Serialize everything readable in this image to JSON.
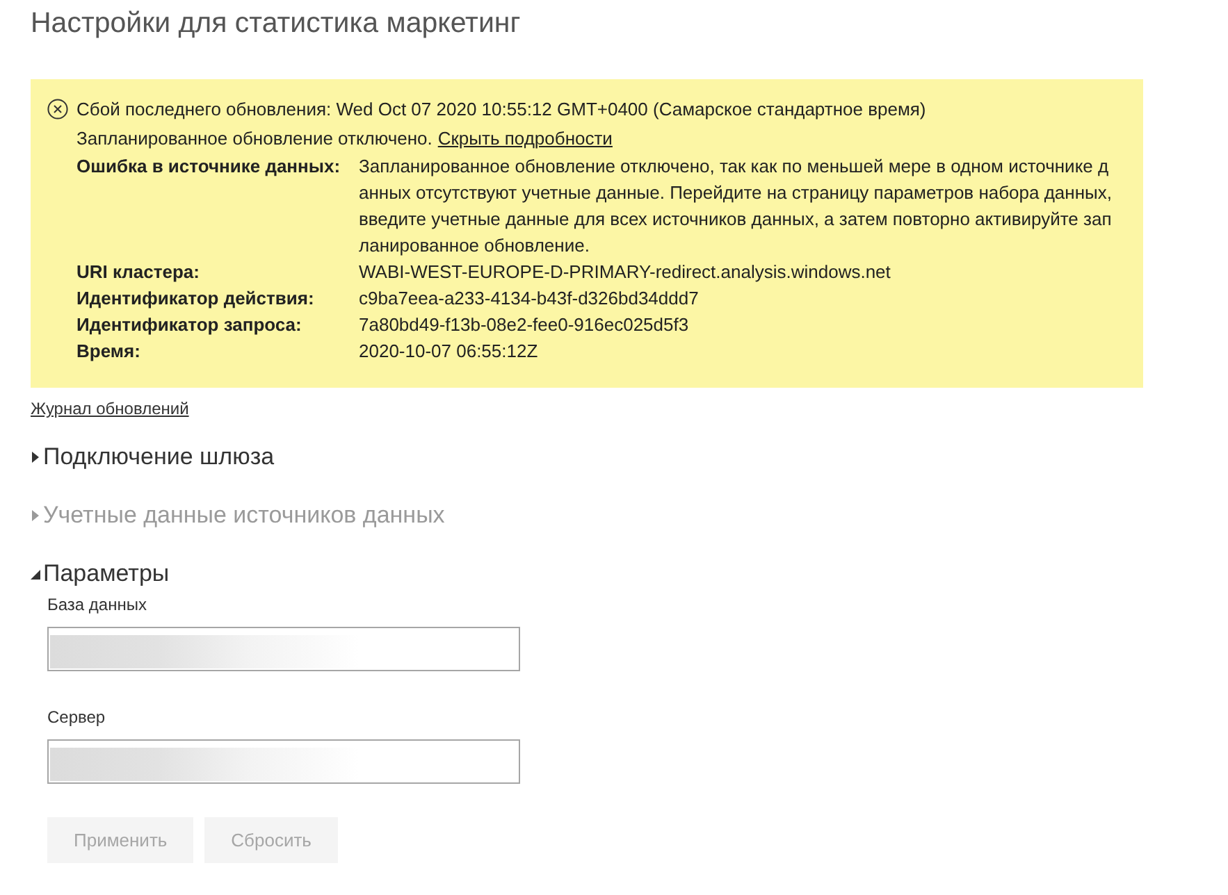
{
  "page": {
    "title": "Настройки для статистика маркетинг"
  },
  "alert": {
    "heading": "Сбой последнего обновления: Wed Oct 07 2020 10:55:12 GMT+0400 (Самарское стандартное время)",
    "message": "Запланированное обновление отключено.",
    "link": "Скрыть подробности",
    "details": [
      {
        "label": "Ошибка в источнике данных:",
        "value": "Запланированное обновление отключено, так как по меньшей мере в одном источнике данных отсутствуют учетные данные. Перейдите на страницу параметров набора данных, введите учетные данные для всех источников данных, а затем повторно активируйте запланированное обновление."
      },
      {
        "label": "URI кластера:",
        "value": "WABI-WEST-EUROPE-D-PRIMARY-redirect.analysis.windows.net"
      },
      {
        "label": "Идентификатор действия:",
        "value": "c9ba7eea-a233-4134-b43f-d326bd34ddd7"
      },
      {
        "label": "Идентификатор запроса:",
        "value": "7a80bd49-f13b-08e2-fee0-916ec025d5f3"
      },
      {
        "label": "Время:",
        "value": "2020-10-07 06:55:12Z"
      }
    ]
  },
  "history_link": "Журнал обновлений",
  "sections": [
    {
      "title": "Подключение шлюза",
      "expanded": false,
      "disabled": false
    },
    {
      "title": "Учетные данные источников данных",
      "expanded": false,
      "disabled": true
    },
    {
      "title": "Параметры",
      "expanded": true,
      "disabled": false,
      "fields": [
        {
          "label": "База данных",
          "redacted": true
        },
        {
          "label": "Сервер",
          "redacted": true
        }
      ],
      "buttons": [
        {
          "label": "Применить",
          "disabled": true
        },
        {
          "label": "Сбросить",
          "disabled": true
        }
      ]
    }
  ]
}
